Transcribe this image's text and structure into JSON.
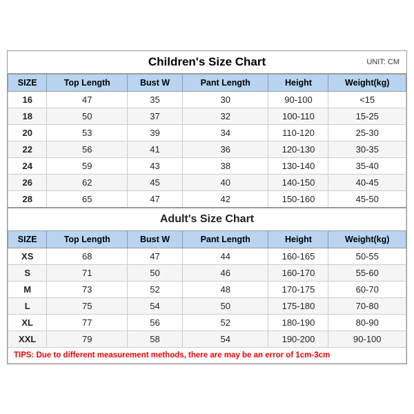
{
  "title": "Children's Size Chart",
  "unit": "UNIT: CM",
  "adults_title": "Adult's Size Chart",
  "tips": "TIPS: Due to different measurement methods, there are may be an error of 1cm-3cm",
  "headers": [
    "SIZE",
    "Top Length",
    "Bust W",
    "Pant Length",
    "Height",
    "Weight(kg)"
  ],
  "children_rows": [
    [
      "16",
      "47",
      "35",
      "30",
      "90-100",
      "<15"
    ],
    [
      "18",
      "50",
      "37",
      "32",
      "100-110",
      "15-25"
    ],
    [
      "20",
      "53",
      "39",
      "34",
      "110-120",
      "25-30"
    ],
    [
      "22",
      "56",
      "41",
      "36",
      "120-130",
      "30-35"
    ],
    [
      "24",
      "59",
      "43",
      "38",
      "130-140",
      "35-40"
    ],
    [
      "26",
      "62",
      "45",
      "40",
      "140-150",
      "40-45"
    ],
    [
      "28",
      "65",
      "47",
      "42",
      "150-160",
      "45-50"
    ]
  ],
  "adult_rows": [
    [
      "XS",
      "68",
      "47",
      "44",
      "160-165",
      "50-55"
    ],
    [
      "S",
      "71",
      "50",
      "46",
      "160-170",
      "55-60"
    ],
    [
      "M",
      "73",
      "52",
      "48",
      "170-175",
      "60-70"
    ],
    [
      "L",
      "75",
      "54",
      "50",
      "175-180",
      "70-80"
    ],
    [
      "XL",
      "77",
      "56",
      "52",
      "180-190",
      "80-90"
    ],
    [
      "XXL",
      "79",
      "58",
      "54",
      "190-200",
      "90-100"
    ]
  ]
}
